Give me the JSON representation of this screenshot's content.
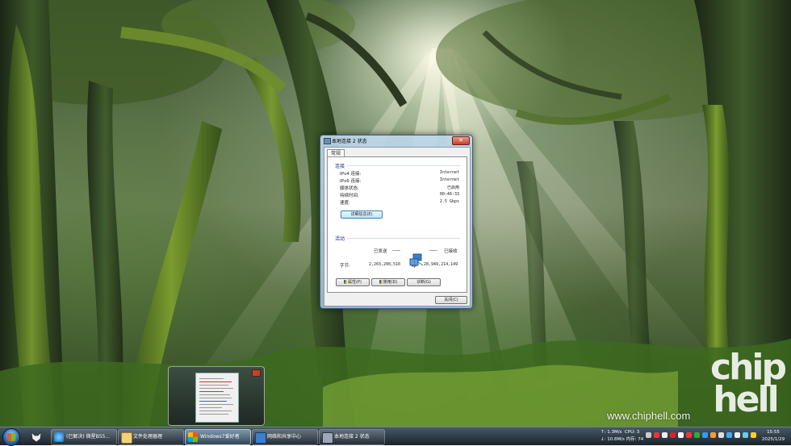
{
  "desktop": {
    "watermark_text": "chip hell",
    "site_url": "www.chiphell.com"
  },
  "dialog": {
    "title": "本地连接 2 状态",
    "close_glyph": "✕",
    "tab_general": "常规",
    "connection": {
      "heading": "连接",
      "rows": [
        {
          "label": "IPv4 连接:",
          "value": "Internet"
        },
        {
          "label": "IPv6 连接:",
          "value": "Internet"
        },
        {
          "label": "媒体状态:",
          "value": "已启用"
        },
        {
          "label": "持续时间:",
          "value": "00:46:33"
        },
        {
          "label": "速度:",
          "value": "2.5 Gbps"
        }
      ],
      "details_button": "详细信息(E)"
    },
    "activity": {
      "heading": "活动",
      "sent_label": "已发送",
      "received_label": "已接收",
      "bytes_label": "字节:",
      "bytes_sent": "2,203,200,510",
      "bytes_received": "28,949,214,149"
    },
    "buttons": {
      "properties": "属性(P)",
      "disable": "禁用(D)",
      "diagnose": "诊断(G)",
      "close": "关闭(C)"
    }
  },
  "taskbar": {
    "tasks": [
      {
        "label": "(已解决) 微星B55..."
      },
      {
        "label": "文件处理器理"
      },
      {
        "label": "Windows7爱好者"
      },
      {
        "label": "网络和共享中心"
      },
      {
        "label": "本地连接 2 状态"
      }
    ],
    "net_up": "↑: 1.3M/s",
    "cpu": "CPU: 3",
    "net_down": "↓: 10.8M/s",
    "mem": "内存: 74",
    "time": "15:55",
    "date": "2025/1/29"
  },
  "colors": {
    "accent_blue": "#1e2a8a",
    "close_red": "#c8402a"
  }
}
